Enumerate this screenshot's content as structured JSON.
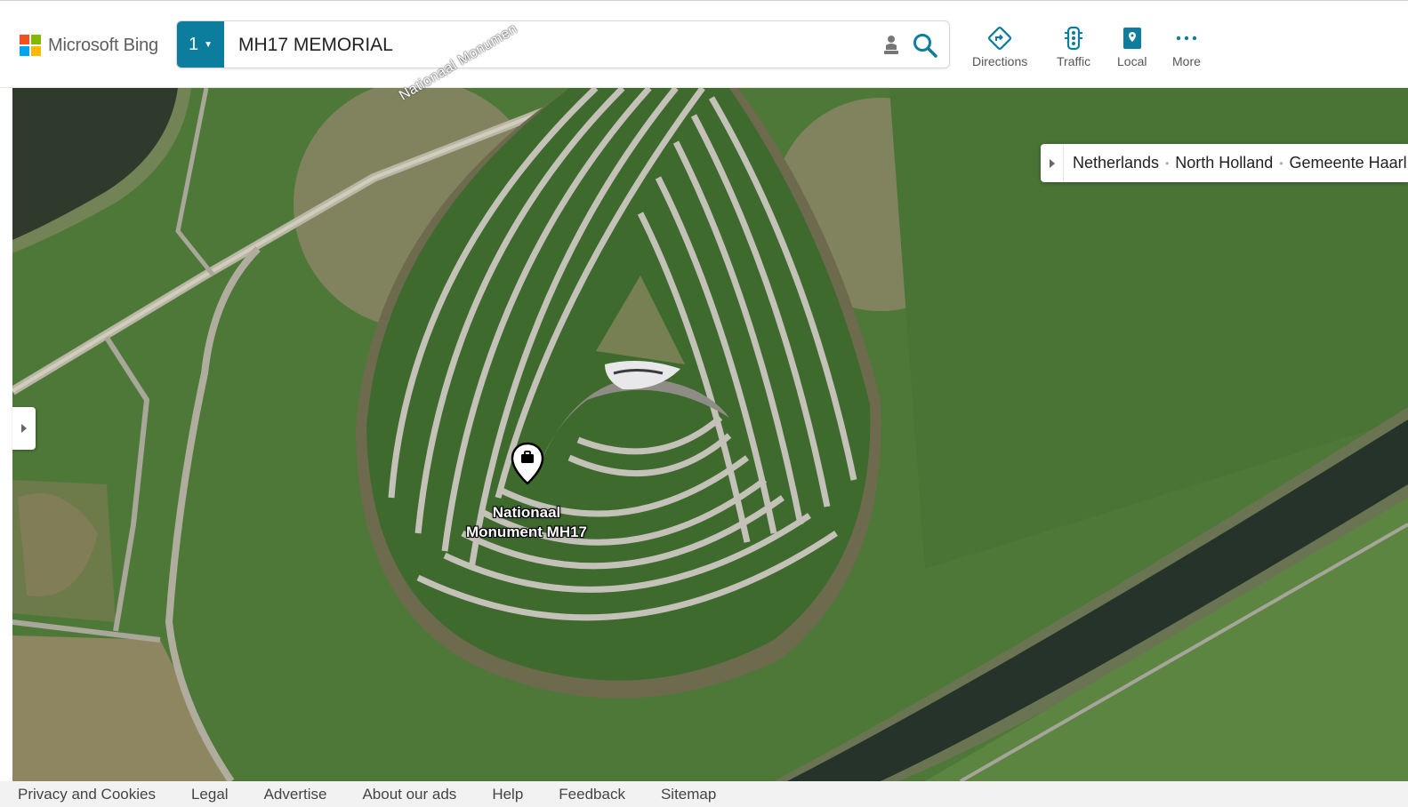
{
  "brand": {
    "name": "Microsoft Bing",
    "colors": [
      "#f25022",
      "#7fba00",
      "#00a4ef",
      "#ffb900"
    ]
  },
  "search": {
    "result_count": "1",
    "query": "MH17 MEMORIAL"
  },
  "nav": {
    "directions": "Directions",
    "traffic": "Traffic",
    "local": "Local",
    "more": "More"
  },
  "breadcrumb": {
    "items": [
      "Netherlands",
      "North Holland",
      "Gemeente Haarl"
    ]
  },
  "map": {
    "pin_label_line1": "Nationaal",
    "pin_label_line2": "Monument MH17",
    "road_label": "Nationaal Monumen",
    "accent": "#0c7d9c"
  },
  "footer": {
    "links": [
      "Privacy and Cookies",
      "Legal",
      "Advertise",
      "About our ads",
      "Help",
      "Feedback",
      "Sitemap"
    ]
  }
}
